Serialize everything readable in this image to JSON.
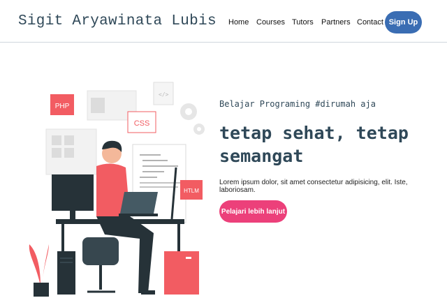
{
  "brand": "Sigit Aryawinata Lubis",
  "nav": {
    "items": [
      "Home",
      "Courses",
      "Tutors",
      "Partners",
      "Contact"
    ],
    "signup_label": "Sign Up"
  },
  "hero": {
    "tagline": "Belajar Programing #dirumah aja",
    "headline_line1": "tetap sehat, tetap",
    "headline_line2": "semangat",
    "description": "Lorem ipsum dolor, sit amet consectetur adipisicing, elit. Iste, laboriosam.",
    "cta_label": "Pelajari lebih lanjut"
  },
  "illustration": {
    "php_label": "PHP",
    "css_label": "CSS",
    "html_label": "HTLM",
    "colors": {
      "accent": "#f25c62",
      "dark": "#263238",
      "brand": "#2f4858",
      "button": "#3a6db3",
      "cta": "#ec407a"
    }
  }
}
